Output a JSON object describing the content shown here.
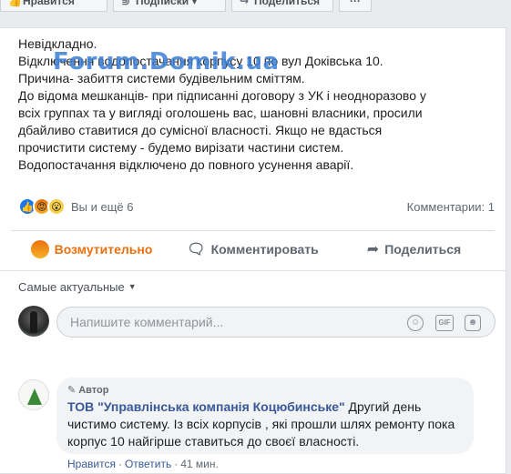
{
  "top_buttons": {
    "like": "Нравится",
    "subscribe": "Подписки",
    "share": "Поделиться",
    "more": "···"
  },
  "watermark": "Forum.Domik.ua",
  "post": {
    "lines": [
      "Невідкладно.",
      "Відключення водопостачання корпусу 10 по вул Доківська 10.",
      "Причина- забиття системи будівельним сміттям.",
      "До відома мешканців- при підписанні договору з УК і неодноразово у",
      "всіх группах та у вигляді оголошень вас, шановні власники, просили",
      "дбайливо ставитися до сумісної власності. Якщо не вдасться",
      "прочистити систему - будемо вирізати частини систем.",
      "Водопостачання відключено до повного усунення аварії."
    ]
  },
  "reactions": {
    "summary": "Вы и ещё 6",
    "comments": "Комментарии: 1"
  },
  "actions": {
    "reaction_label": "Возмутительно",
    "comment_label": "Комментировать",
    "share_label": "Поделиться"
  },
  "comments_section": {
    "sort_label": "Самые актуальные",
    "composer_placeholder": "Напишите комментарий...",
    "icons": [
      "emoji-icon",
      "gif-icon",
      "sticker-icon"
    ]
  },
  "comment": {
    "badge": "Автор",
    "author": "ТОВ \"Управлінська компанія Коцюбинське\"",
    "line1": " Другий день",
    "line2": "чистимо систему. Із всіх корпусів , які прошли шлях ремонту пока",
    "line3": "корпус 10 найгірше ставиться до своєї власності.",
    "like_link": "Нравится",
    "reply_link": "Ответить",
    "time": "41 мин."
  },
  "colors": {
    "link": "#385898",
    "angry": "#e9710f",
    "watermark": "#3b7fd6"
  }
}
